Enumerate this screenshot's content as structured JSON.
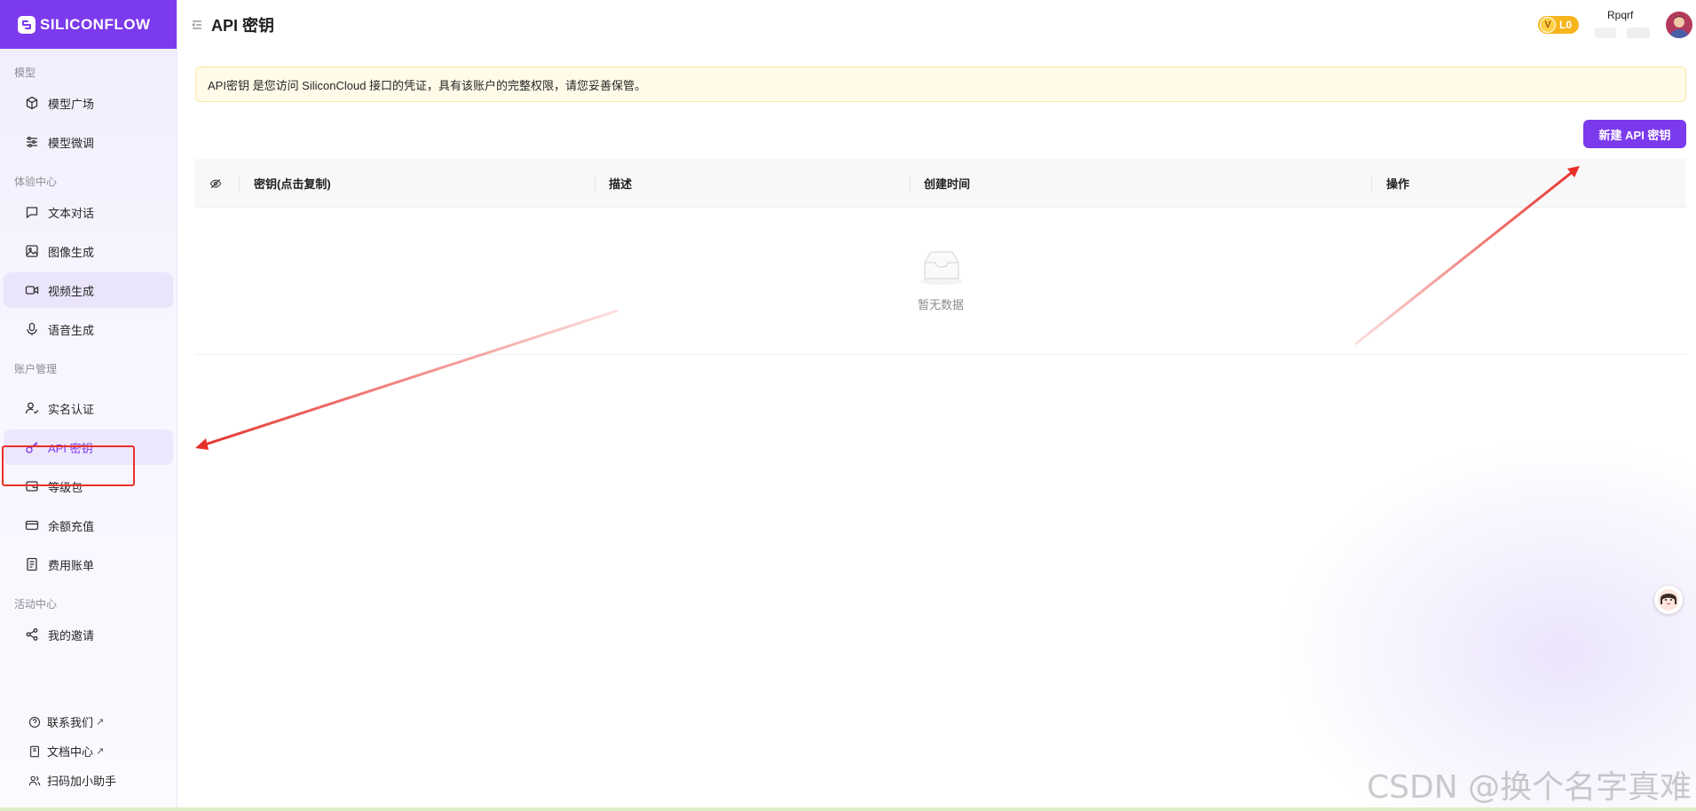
{
  "brand": {
    "name": "SILICONFLOW"
  },
  "header": {
    "title": "API 密钥",
    "level": "L0",
    "level_letter": "V",
    "user_name": "Rpqrf"
  },
  "sidebar": {
    "sections": [
      {
        "label": "模型",
        "items": [
          {
            "label": "模型广场",
            "icon": "cube-icon"
          },
          {
            "label": "模型微调",
            "icon": "sliders-icon"
          }
        ]
      },
      {
        "label": "体验中心",
        "items": [
          {
            "label": "文本对话",
            "icon": "chat-icon"
          },
          {
            "label": "图像生成",
            "icon": "image-icon"
          },
          {
            "label": "视频生成",
            "icon": "video-icon"
          },
          {
            "label": "语音生成",
            "icon": "mic-icon"
          }
        ]
      },
      {
        "label": "账户管理",
        "items": [
          {
            "label": "实名认证",
            "icon": "user-check-icon"
          },
          {
            "label": "API 密钥",
            "icon": "key-icon"
          },
          {
            "label": "等级包",
            "icon": "wallet-icon"
          },
          {
            "label": "余额充值",
            "icon": "credit-card-icon"
          },
          {
            "label": "费用账单",
            "icon": "receipt-icon"
          }
        ]
      },
      {
        "label": "活动中心",
        "items": [
          {
            "label": "我的邀请",
            "icon": "share-icon"
          }
        ]
      }
    ],
    "footer": [
      {
        "label": "联系我们",
        "ext": "↗",
        "icon": "help-circle-icon"
      },
      {
        "label": "文档中心",
        "ext": "↗",
        "icon": "book-icon"
      },
      {
        "label": "扫码加小助手",
        "icon": "users-icon"
      }
    ]
  },
  "notice": {
    "text": "API密钥 是您访问 SiliconCloud 接口的凭证，具有该账户的完整权限，请您妥善保管。"
  },
  "actions": {
    "new_key_label": "新建 API 密钥"
  },
  "table": {
    "columns": [
      "密钥(点击复制)",
      "描述",
      "创建时间",
      "操作"
    ],
    "rows": [],
    "empty_text": "暂无数据"
  },
  "watermark": "CSDN @换个名字真难",
  "colors": {
    "accent": "#7c3aed",
    "annotation_red": "#e8302a",
    "badge_gold": "#f6b51c"
  }
}
